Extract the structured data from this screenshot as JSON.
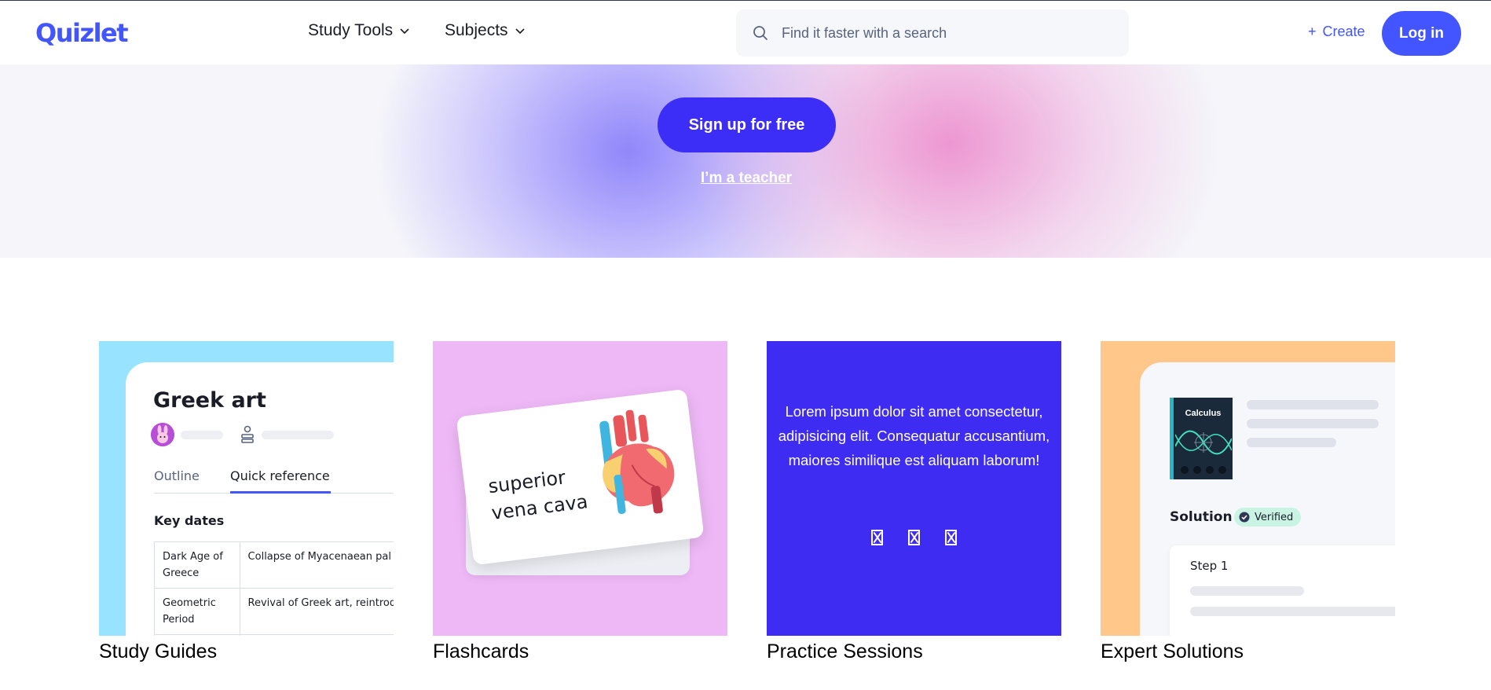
{
  "header": {
    "logo": "Quizlet",
    "nav": [
      {
        "label": "Study Tools"
      },
      {
        "label": "Subjects"
      }
    ],
    "search": {
      "placeholder": "Find it faster with a search"
    },
    "create_label": "Create",
    "login_label": "Log in"
  },
  "hero": {
    "signup_label": "Sign up for free",
    "teacher_label": "I’m a teacher"
  },
  "cards": {
    "study_guides": {
      "title": "Study Guides",
      "doc_title": "Greek art",
      "tab_outline": "Outline",
      "tab_quick": "Quick reference",
      "section": "Key dates",
      "rows": [
        {
          "term": "Dark Age of Greece",
          "desc": "Collapse of Myacenaean pal"
        },
        {
          "term": "Geometric Period",
          "desc": "Revival of Greek art, reintrod"
        }
      ]
    },
    "flashcards": {
      "title": "Flashcards",
      "word_line1": "superior",
      "word_line2": "vena cava"
    },
    "practice": {
      "title": "Practice Sessions",
      "text": "Lorem ipsum dolor sit amet consectetur, adipisicing elit. Consequatur accusantium, maiores similique est aliquam laborum!"
    },
    "expert": {
      "title": "Expert Solutions",
      "book_title": "Calculus",
      "solution_label": "Solution",
      "verified_label": "Verified",
      "step_label": "Step 1"
    }
  },
  "colors": {
    "brand": "#4255ff",
    "signup": "#3c2ef6",
    "practice_bg": "#3f2cf2"
  }
}
